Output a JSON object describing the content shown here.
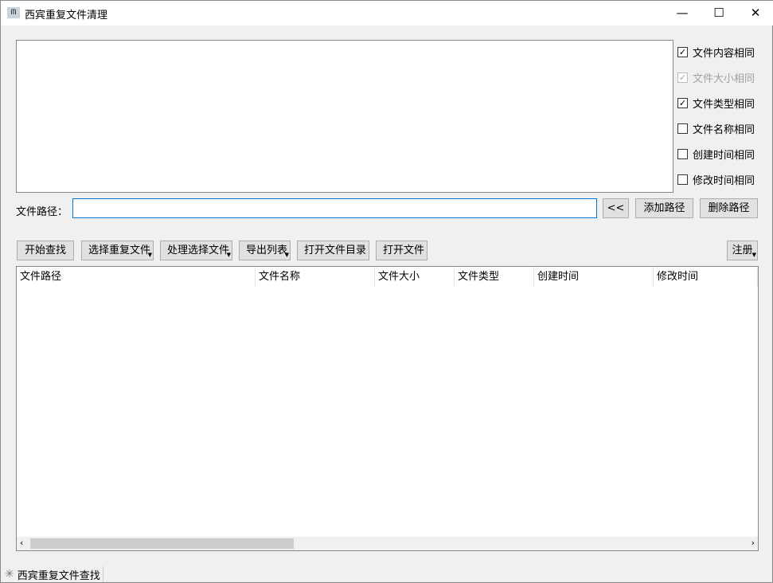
{
  "window": {
    "title": "西宾重复文件清理",
    "minimize": "—",
    "maximize": "☐",
    "close": "✕",
    "icon": "app-icon"
  },
  "options": [
    {
      "label": "文件内容相同",
      "checked": true,
      "disabled": false
    },
    {
      "label": "文件大小相同",
      "checked": true,
      "disabled": true
    },
    {
      "label": "文件类型相同",
      "checked": true,
      "disabled": false
    },
    {
      "label": "文件名称相同",
      "checked": false,
      "disabled": false
    },
    {
      "label": "创建时间相同",
      "checked": false,
      "disabled": false
    },
    {
      "label": "修改时间相同",
      "checked": false,
      "disabled": false
    }
  ],
  "path": {
    "label": "文件路径：",
    "value": "",
    "back": "<<",
    "add": "添加路径",
    "remove": "删除路径"
  },
  "toolbar": {
    "start": "开始查找",
    "select": "选择重复文件",
    "process": "处理选择文件",
    "export": "导出列表",
    "open_dir": "打开文件目录",
    "open_file": "打开文件",
    "register": "注册"
  },
  "table": {
    "columns": [
      "文件路径",
      "文件名称",
      "文件大小",
      "文件类型",
      "创建时间",
      "修改时间"
    ]
  },
  "status": {
    "text": "西宾重复文件查找"
  }
}
